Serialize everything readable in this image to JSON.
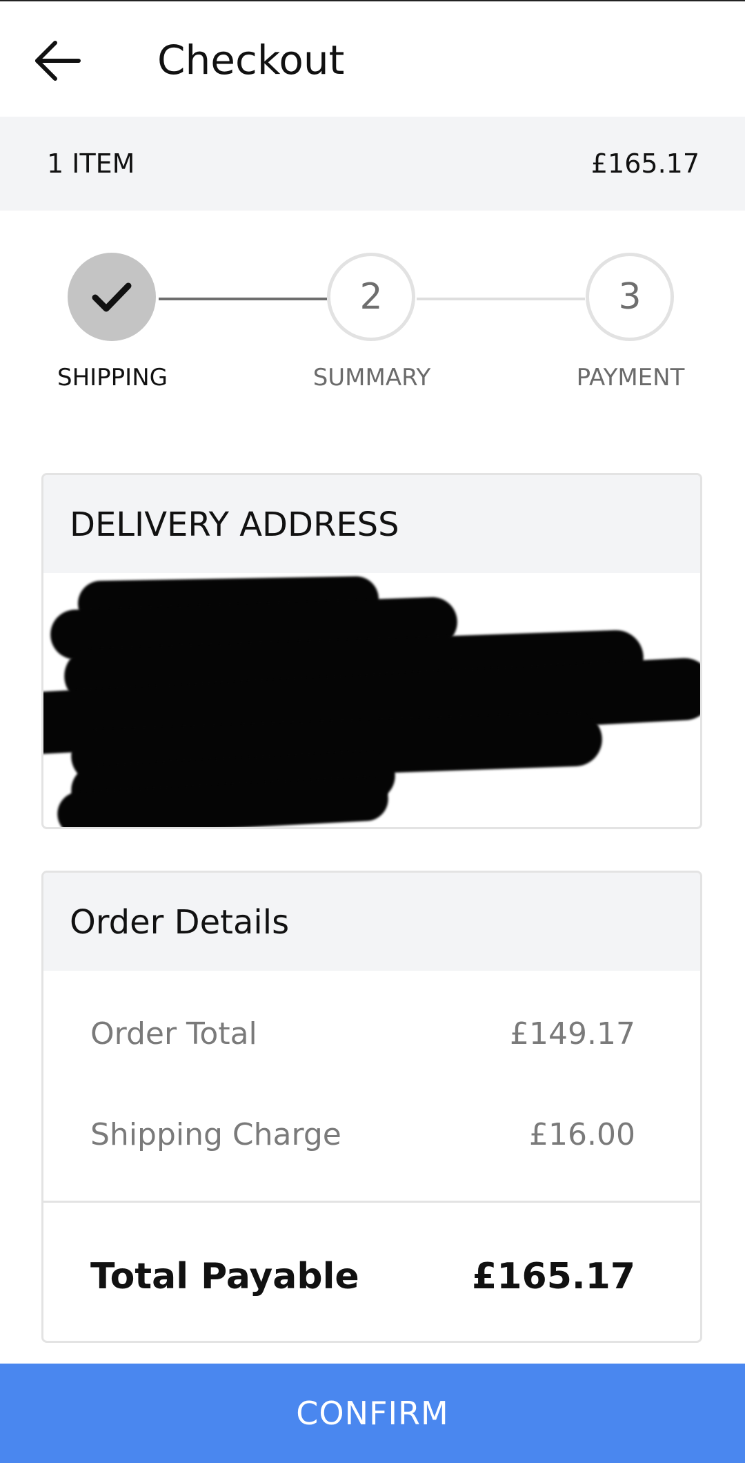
{
  "header": {
    "title": "Checkout",
    "back_icon": "arrow-left-icon"
  },
  "cart_summary": {
    "items_count": "1 ITEM",
    "total": "£165.17"
  },
  "stepper": {
    "steps": [
      {
        "label": "SHIPPING",
        "number": "1",
        "state": "completed",
        "icon": "check-icon"
      },
      {
        "label": "SUMMARY",
        "number": "2",
        "state": "pending"
      },
      {
        "label": "PAYMENT",
        "number": "3",
        "state": "pending"
      }
    ]
  },
  "delivery_address": {
    "title": "DELIVERY ADDRESS"
  },
  "order_details": {
    "title": "Order Details",
    "rows": [
      {
        "label": "Order Total",
        "value": "£149.17"
      },
      {
        "label": "Shipping Charge",
        "value": "£16.00"
      }
    ],
    "total": {
      "label": "Total Payable",
      "value": "£165.17"
    }
  },
  "footer": {
    "confirm_label": "CONFIRM"
  },
  "colors": {
    "accent": "#4a87ef",
    "completed_step": "#c4c4c4",
    "panel_background": "#f3f4f6"
  }
}
